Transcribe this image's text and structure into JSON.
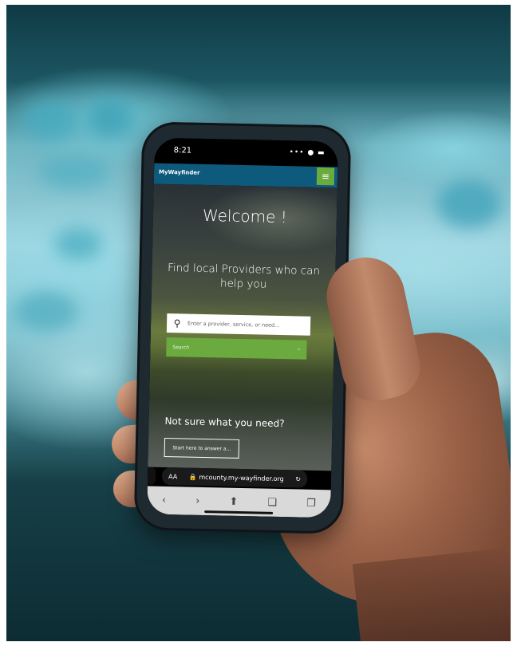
{
  "status_bar": {
    "time": "8:21",
    "icons": "••• ● ▬"
  },
  "app": {
    "brand": "MyWayfinder",
    "menu_icon": "≡"
  },
  "hero": {
    "welcome": "Welcome !",
    "tagline": "Find local Providers who can help you",
    "search_placeholder": "Enter a provider, service, or need...",
    "search_button": "Search",
    "search_button_icon": "⌕",
    "not_sure": "Not sure what you need?",
    "start_button": "Start here to answer a..."
  },
  "browser": {
    "url_aa": "AA",
    "url": "🔒 mcounty.my-wayfinder.org",
    "reload_icon": "↻",
    "toolbar": [
      "‹",
      "›",
      "⬆",
      "❑",
      "❐"
    ]
  }
}
